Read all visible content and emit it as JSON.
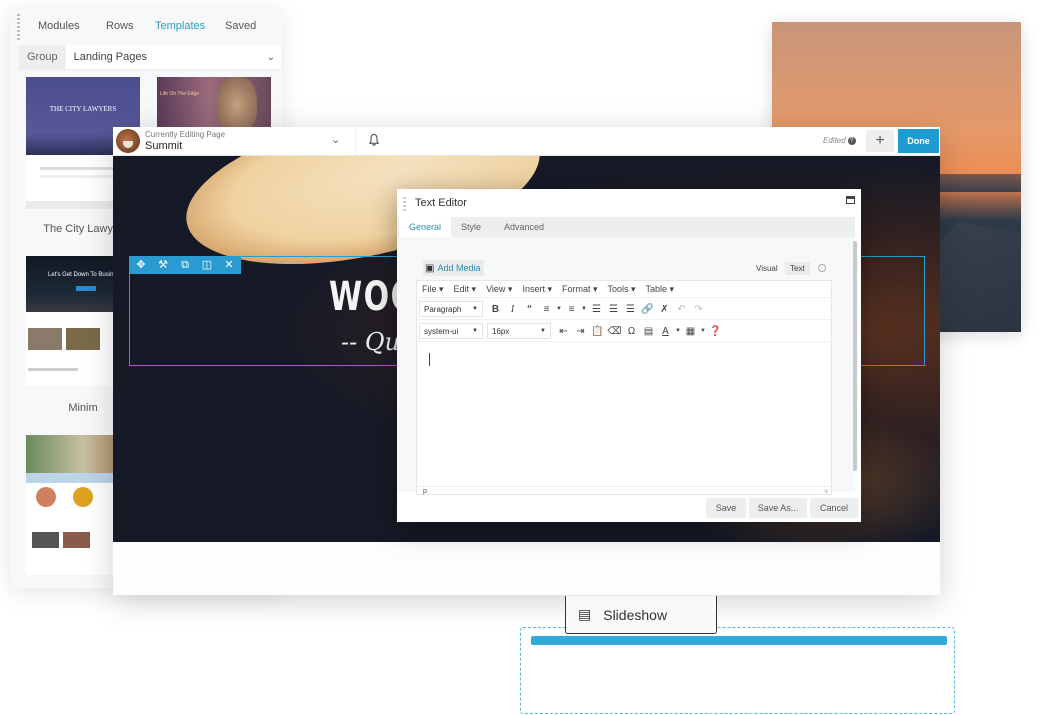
{
  "left_panel": {
    "tabs": [
      "Modules",
      "Rows",
      "Templates",
      "Saved"
    ],
    "active_tab": "Templates",
    "group_label": "Group",
    "group_value": "Landing Pages",
    "templates": [
      {
        "name": "The City Lawyer",
        "hero_text": "THE CITY LAWYERS"
      },
      {
        "name": "",
        "hero_text": "Life On The Edge"
      },
      {
        "name": "Minim",
        "hero_text": "Let's Get Down To Business"
      },
      {
        "name": "",
        "hero_text": ""
      }
    ]
  },
  "builder": {
    "subtitle": "Currently Editing Page",
    "page_title": "Summit",
    "edited_label": "Edited",
    "add_label": "+",
    "done_label": "Done",
    "hero_heading": "WOO",
    "hero_subheading": "-- Qu",
    "row_tools": [
      "move-icon",
      "wrench-icon",
      "duplicate-icon",
      "columns-icon",
      "close-icon"
    ]
  },
  "text_editor": {
    "title": "Text Editor",
    "tabs": [
      "General",
      "Style",
      "Advanced"
    ],
    "active_tab": "General",
    "add_media_label": "Add Media",
    "view_modes": [
      "Visual",
      "Text"
    ],
    "menubar": [
      "File ▾",
      "Edit ▾",
      "View ▾",
      "Insert ▾",
      "Format ▾",
      "Tools ▾",
      "Table ▾"
    ],
    "block_format": "Paragraph",
    "font_family": "system-ui",
    "font_size": "16px",
    "content": "",
    "status_path": "p",
    "buttons": {
      "save": "Save",
      "save_as": "Save As...",
      "cancel": "Cancel"
    }
  },
  "drag": {
    "module_label": "Slideshow"
  },
  "colors": {
    "accent": "#1e9bd0",
    "tab_active": "#2a9bbd",
    "dropzone_bar": "#33a9dc"
  }
}
